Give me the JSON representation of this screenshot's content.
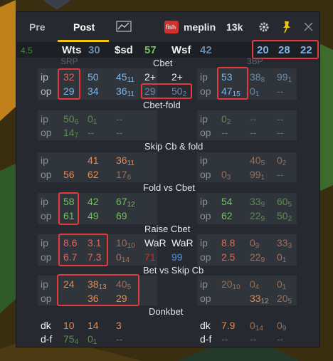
{
  "tabs": {
    "pre": "Pre",
    "post": "Post"
  },
  "player": {
    "badge": "fish",
    "name": "meplin",
    "hands": "13k"
  },
  "colors": {
    "accent": "#f1c40f",
    "highlight": "#e5393d",
    "badge": "#d0312d"
  },
  "header": {
    "vpip": "4.5",
    "wts": "Wts",
    "wts_val": "30",
    "sd": "$sd",
    "sd_val": "57",
    "wsf": "Wsf",
    "wsf_val": "42",
    "r1": "20",
    "r2": "28",
    "r3": "22"
  },
  "sections": {
    "srp": "SRP",
    "threebp": "3BP",
    "cbet": "Cbet",
    "cbet_fold": "Cbet-fold",
    "skip": "Skip Cb & fold",
    "fold_vs": "Fold vs  Cbet",
    "raise": "Raise Cbet",
    "bet_skip": "Bet vs Skip Cb",
    "donk": "Donkbet"
  },
  "labels": {
    "ip": "ip",
    "op": "op",
    "twobet": "2+",
    "war": "WaR",
    "dk": "dk",
    "df": "d-f",
    "dash": "--"
  },
  "cbet": {
    "l_ip": [
      "32",
      "50",
      "45",
      "11"
    ],
    "l_op": [
      "29",
      "34",
      "36",
      "11"
    ],
    "m_op": [
      "29",
      "50",
      "2"
    ],
    "r_ip": [
      "53",
      "38",
      "8",
      "99",
      "1"
    ],
    "r_op": [
      "47",
      "15",
      "0",
      "1"
    ]
  },
  "cbet_fold": {
    "l_ip": [
      "50",
      "6",
      "0",
      "1"
    ],
    "l_op": [
      "14",
      "7"
    ],
    "r_ip": [
      "0",
      "2"
    ]
  },
  "skip": {
    "l_ip": [
      "41",
      "36",
      "11"
    ],
    "l_op": [
      "56",
      "62",
      "17",
      "6"
    ],
    "r_ip": [
      "40",
      "5",
      "0",
      "2"
    ],
    "r_op": [
      "0",
      "3",
      "99",
      "1"
    ]
  },
  "fold_vs": {
    "l_ip": [
      "58",
      "42",
      "67",
      "12"
    ],
    "l_op": [
      "61",
      "49",
      "69"
    ],
    "r_ip": [
      "54",
      "33",
      "9",
      "60",
      "5"
    ],
    "r_op": [
      "62",
      "22",
      "9",
      "50",
      "2"
    ]
  },
  "raise": {
    "l_ip": [
      "8.6",
      "3.1",
      "10",
      "10"
    ],
    "l_op": [
      "6.7",
      "7.3",
      "0",
      "14"
    ],
    "m_ip": [
      "71",
      "99"
    ],
    "r_ip": [
      "8.8",
      "0",
      "9",
      "33",
      "3"
    ],
    "r_op": [
      "2.5",
      "22",
      "9",
      "0",
      "1"
    ]
  },
  "bet_skip": {
    "l_ip": [
      "24",
      "38",
      "13",
      "40",
      "5"
    ],
    "l_op": [
      "36",
      "29"
    ],
    "r_ip": [
      "20",
      "10",
      "0",
      "4",
      "0",
      "1"
    ],
    "r_op": [
      "33",
      "12",
      "20",
      "5"
    ]
  },
  "donk": {
    "l_dk": [
      "10",
      "14",
      "3"
    ],
    "l_df": [
      "75",
      "4",
      "0",
      "1"
    ],
    "r_dk": [
      "7.9",
      "0",
      "14",
      "0",
      "9"
    ]
  }
}
